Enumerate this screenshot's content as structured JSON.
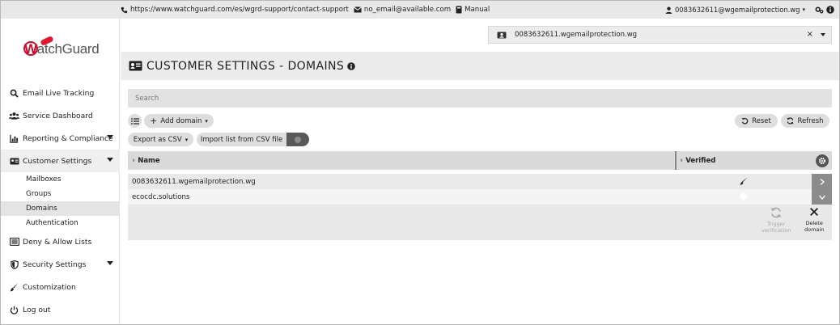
{
  "topbar": {
    "support_url": "https://www.watchguard.com/es/wgrd-support/contact-support",
    "email": "no_email@available.com",
    "manual": "Manual",
    "user": "0083632611@wgemailprotection.wg"
  },
  "logo": {
    "text_a": "W",
    "text_b": "atchGuard"
  },
  "sidebar": {
    "items": [
      {
        "label": "Email Live Tracking",
        "icon": "search-icon"
      },
      {
        "label": "Service Dashboard",
        "icon": "users-icon"
      },
      {
        "label": "Reporting & Compliance",
        "icon": "chart-icon"
      },
      {
        "label": "Customer Settings",
        "icon": "id-card-icon"
      },
      {
        "label": "Deny & Allow Lists",
        "icon": "list-icon"
      },
      {
        "label": "Security Settings",
        "icon": "shield-icon"
      },
      {
        "label": "Customization",
        "icon": "brush-icon"
      },
      {
        "label": "Log out",
        "icon": "power-icon"
      }
    ],
    "sub_items": [
      "Mailboxes",
      "Groups",
      "Domains",
      "Authentication"
    ],
    "active_sub": "Domains"
  },
  "account_selector": {
    "value": "0083632611.wgemailprotection.wg",
    "clear": "×"
  },
  "page": {
    "title": "CUSTOMER SETTINGS - DOMAINS"
  },
  "search": {
    "placeholder": "Search"
  },
  "toolbar": {
    "add_domain": "Add domain",
    "reset": "Reset",
    "refresh": "Refresh",
    "export_csv": "Export as CSV",
    "import_csv": "Import list from CSV file"
  },
  "table": {
    "headers": {
      "name": "Name",
      "verified": "Verified"
    },
    "rows": [
      {
        "name": "0083632611.wgemailprotection.wg",
        "verified": "verified-icon"
      },
      {
        "name": "ecocdc.solutions",
        "verified": "unverified-icon"
      }
    ],
    "actions": {
      "trigger_line1": "Trigger",
      "trigger_line2": "verification",
      "delete_line1": "Delete",
      "delete_line2": "domain"
    }
  },
  "colors": {
    "brand_red": "#c8102e",
    "header_gray": "#ececec"
  }
}
